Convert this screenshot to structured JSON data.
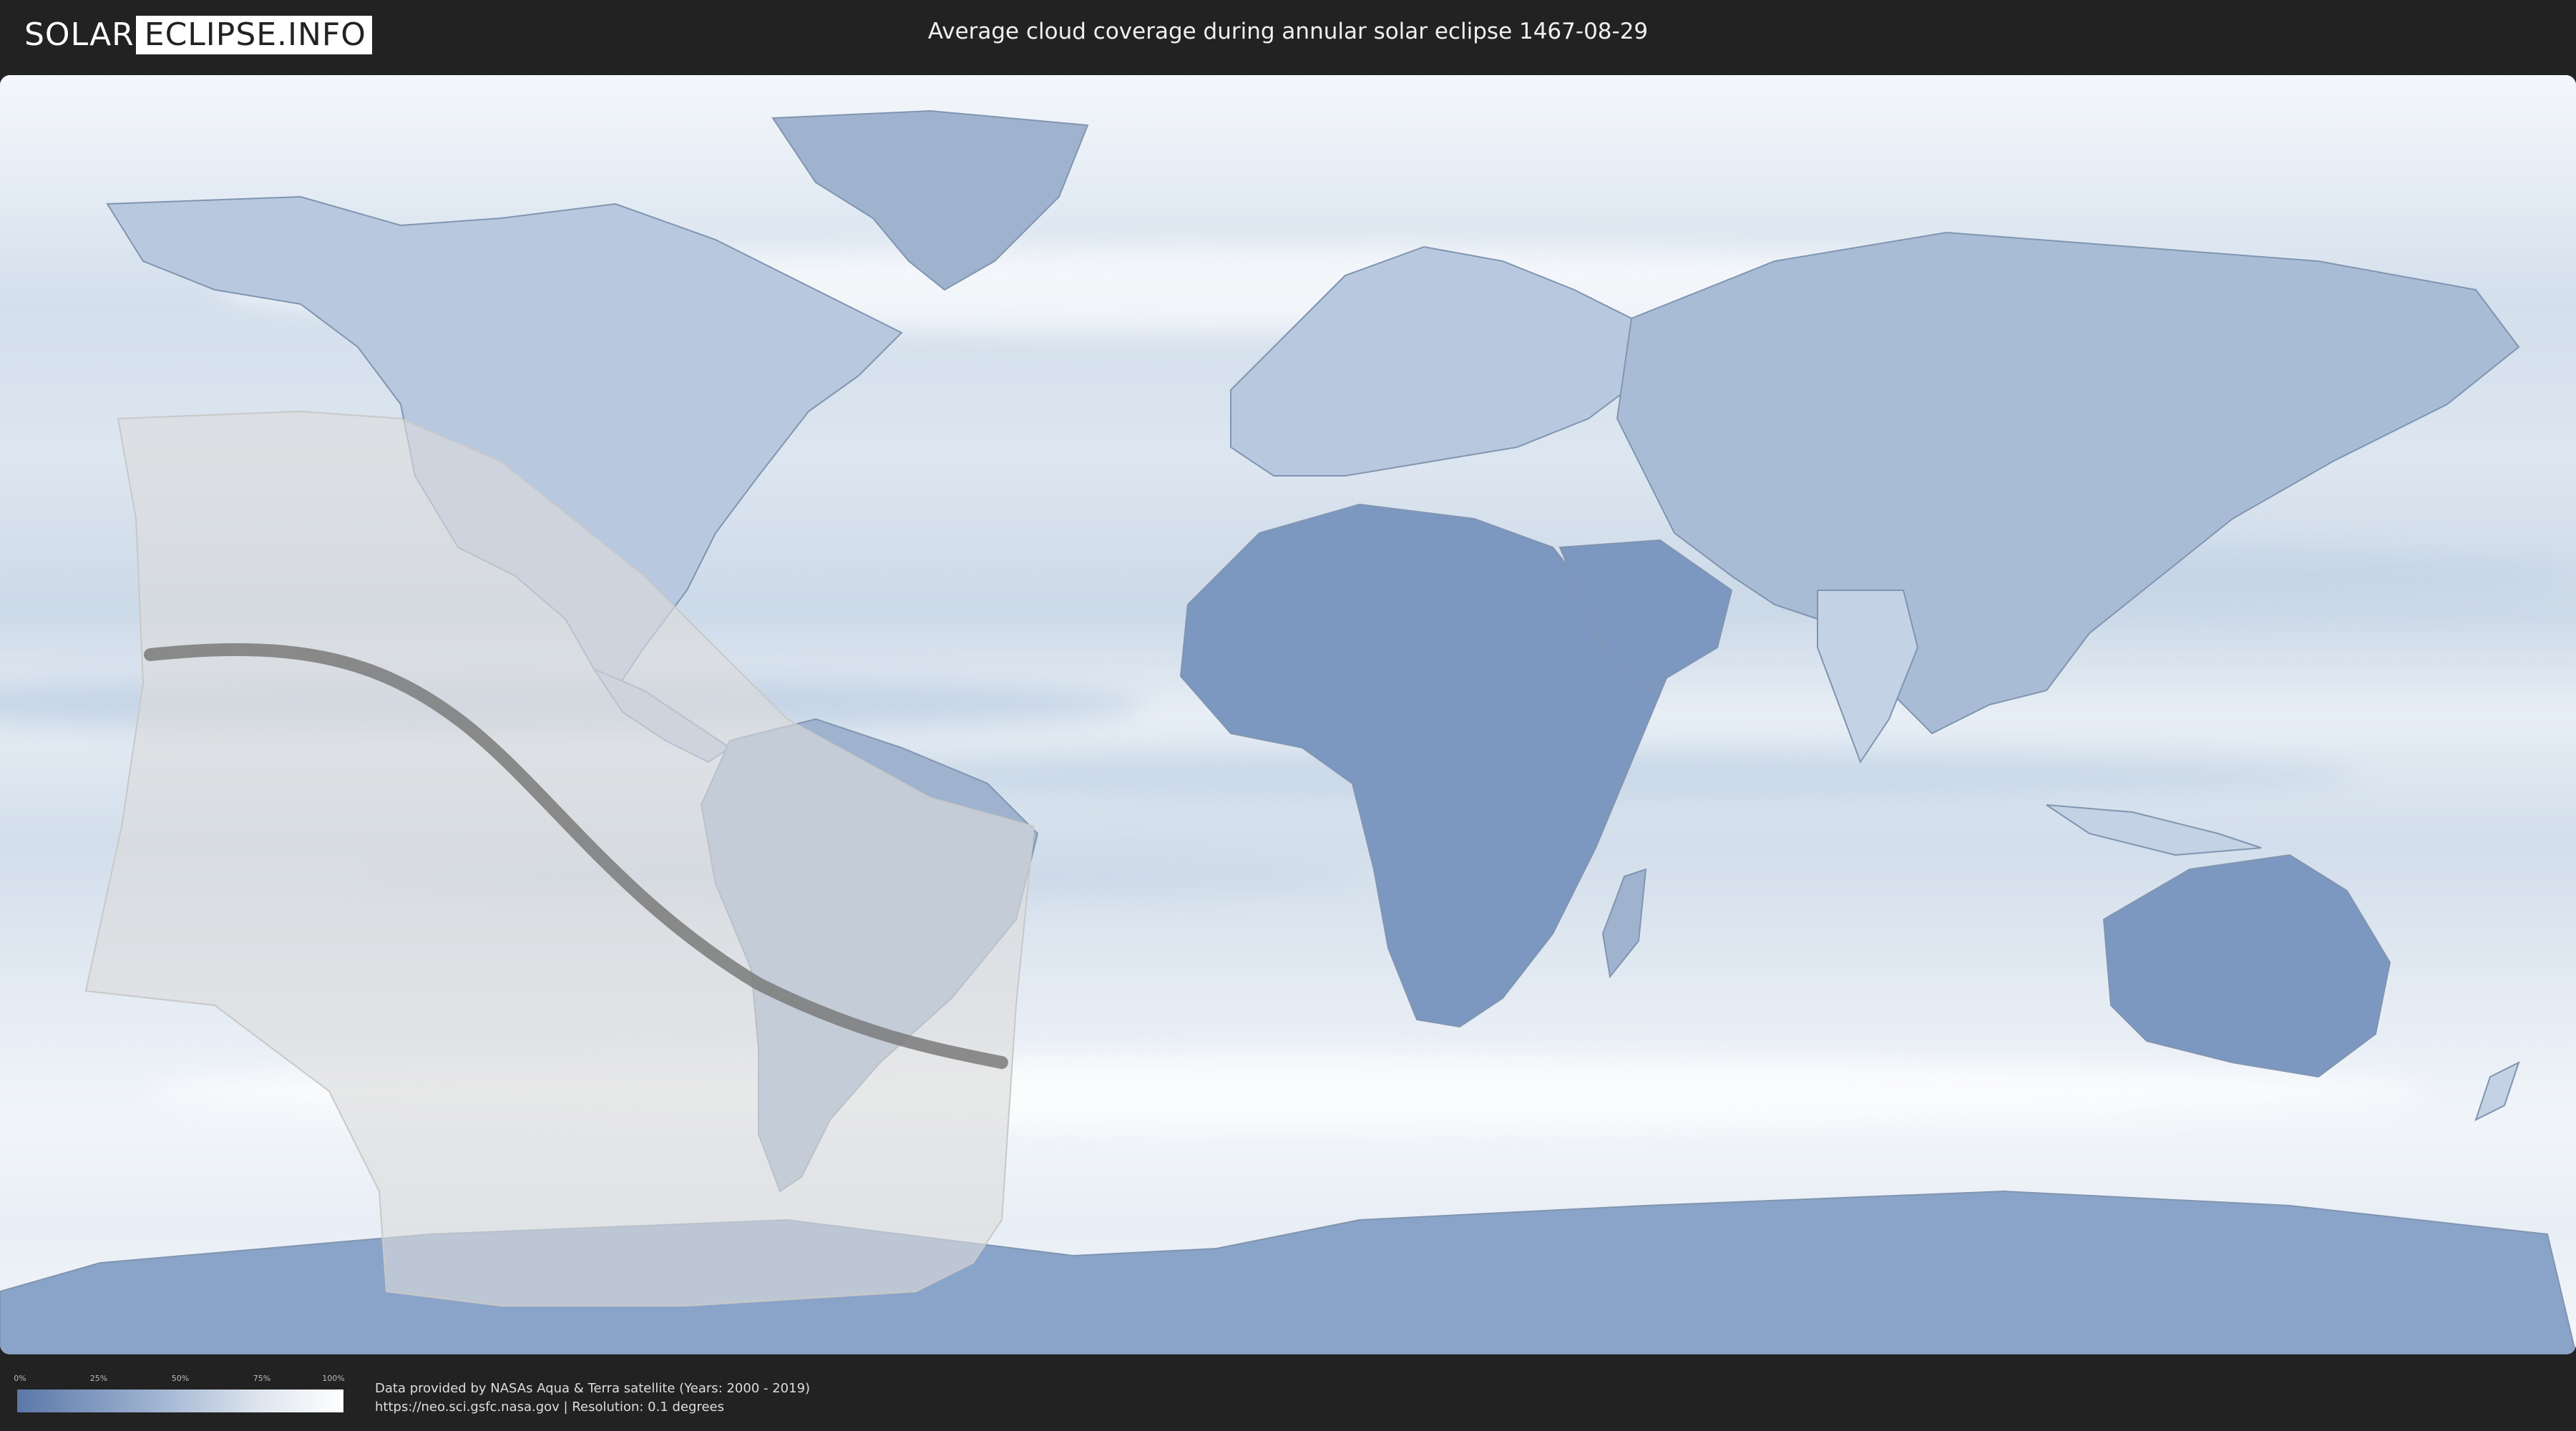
{
  "header": {
    "logo_left": "SOLAR",
    "logo_right": "ECLIPSE.INFO",
    "title": "Average cloud coverage during annular solar eclipse 1467-08-29"
  },
  "legend": {
    "ticks": [
      "0%",
      "25%",
      "50%",
      "75%",
      "100%"
    ],
    "colors": {
      "clear": "#5b78a8",
      "cloudy": "#ffffff"
    }
  },
  "footer": {
    "line1": "Data provided by NASAs Aqua & Terra satellite (Years: 2000 - 2019)",
    "line2": "https://neo.sci.gsfc.nasa.gov | Resolution: 0.1 degrees"
  },
  "map": {
    "projection": "equirectangular",
    "eclipse_type": "annular",
    "colors": {
      "ocean_cloud": "#e9eff6",
      "land_clear": "#6f8cb8",
      "path_line": "#7a7a7a",
      "shadow_area": "#d9d9d9"
    }
  }
}
